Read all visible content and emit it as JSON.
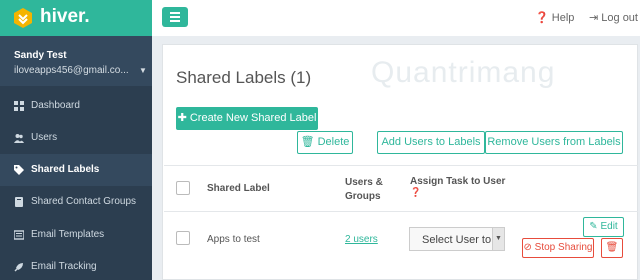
{
  "app": {
    "brand": "hiver.",
    "accent_color": "#2fb79b"
  },
  "user": {
    "name": "Sandy Test",
    "email": "iloveapps456@gmail.co...",
    "caret_icon": "caret-down-icon"
  },
  "sidebar": {
    "items": [
      {
        "label": "Dashboard",
        "icon": "dashboard-icon"
      },
      {
        "label": "Users",
        "icon": "users-icon"
      },
      {
        "label": "Shared Labels",
        "icon": "tag-icon",
        "active": true
      },
      {
        "label": "Shared Contact Groups",
        "icon": "book-icon"
      },
      {
        "label": "Email Templates",
        "icon": "template-icon"
      },
      {
        "label": "Email Tracking",
        "icon": "rocket-icon"
      }
    ]
  },
  "topbar": {
    "help_label": "Help",
    "logout_label": "Log out"
  },
  "main": {
    "title": "Shared Labels (1)",
    "create_button": "Create New Shared Label",
    "delete_button": "Delete",
    "add_users_button": "Add Users to Labels",
    "remove_users_button": "Remove Users from Labels",
    "watermark": "Quantrimang",
    "table": {
      "headers": [
        "Shared Label",
        "Users & Groups",
        "Assign Task to User"
      ],
      "header_help_icon": "question-circle-icon",
      "rows": [
        {
          "label": "Apps to test",
          "users": "2 users",
          "assign_select": "Select User to",
          "edit_button": "Edit",
          "stop_sharing_button": "Stop Sharing"
        }
      ]
    }
  }
}
